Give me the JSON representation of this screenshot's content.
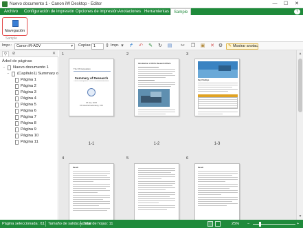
{
  "window": {
    "title": "Nuevo documento 1 - Canon iW Desktop - Editor",
    "minimize_glyph": "—",
    "maximize_glyph": "☐",
    "close_glyph": "✕"
  },
  "ribbon": {
    "tabs": [
      {
        "label": "Archivo"
      },
      {
        "label": "Configuración de impresión"
      },
      {
        "label": "Opciones de impresión"
      },
      {
        "label": "Anotaciones"
      },
      {
        "label": "Herramientas"
      },
      {
        "label": "Sample"
      }
    ],
    "active_tab": "Sample",
    "nav_button_label": "Navegación",
    "group_label": "Sample",
    "help_glyph": "?"
  },
  "toolbar": {
    "printer_label": "Impr.:",
    "printer_value": "Canon iR-ADV",
    "copies_label": "Copias:",
    "copies_value": "1",
    "copies_unit": "Impr.",
    "show_annotations_label": "Mostrar anotac."
  },
  "left_panel": {
    "tree_title": "Árbol de páginas",
    "close_glyph": "✕",
    "tree": [
      {
        "label": "Nuevo documento 1",
        "level": 0,
        "toggle": "−"
      },
      {
        "label": "(Capítulo1) Summary of R",
        "level": 1,
        "toggle": "−"
      },
      {
        "label": "Página 1",
        "level": 2
      },
      {
        "label": "Página 2",
        "level": 2
      },
      {
        "label": "Página 3",
        "level": 2
      },
      {
        "label": "Página 4",
        "level": 2
      },
      {
        "label": "Página 5",
        "level": 2
      },
      {
        "label": "Página 6",
        "level": 2
      },
      {
        "label": "Página 7",
        "level": 2
      },
      {
        "label": "Página 8",
        "level": 2
      },
      {
        "label": "Página 9",
        "level": 2
      },
      {
        "label": "Página 10",
        "level": 2
      },
      {
        "label": "Página 11",
        "level": 2
      }
    ]
  },
  "pages": [
    {
      "number": "1",
      "label": "1-1",
      "header": "The XX Corporation",
      "title": "Summary of Research",
      "subtitle": "Latest Developments in XXX's Environmental Efforts",
      "footer1": "XX Jan, 20XX",
      "footer2": "XX Industrial Laboratory, XXX"
    },
    {
      "number": "2",
      "label": "1-2",
      "heading": "Introduction of XXX's Research Efforts"
    },
    {
      "number": "3",
      "label": "1-3",
      "heading": "Key Findings"
    },
    {
      "number": "4",
      "label": "",
      "heading": "Result"
    },
    {
      "number": "5",
      "label": "",
      "heading": ""
    },
    {
      "number": "6",
      "label": "",
      "heading": "Result"
    }
  ],
  "status": {
    "selected": "Página seleccionada: /11",
    "output_size": "Tamaño de salida:Ajustar",
    "total": "Total de hojas: 11",
    "zoom": "25%"
  }
}
